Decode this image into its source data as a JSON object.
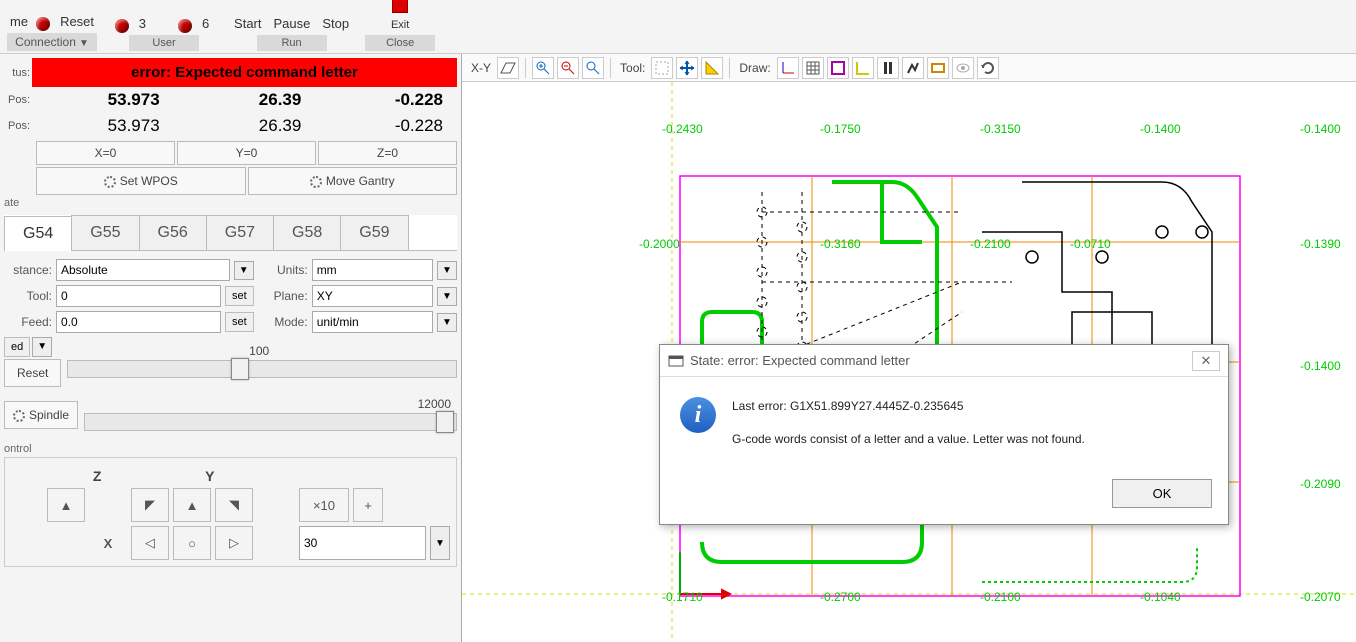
{
  "toolbar": {
    "home_label": "me",
    "reset_label": "Reset",
    "three_label": "3",
    "six_label": "6",
    "start_label": "Start",
    "pause_label": "Pause",
    "stop_label": "Stop",
    "exit_label": "Exit",
    "connection_group": "Connection",
    "user_group": "User",
    "run_group": "Run",
    "close_group": "Close"
  },
  "status": {
    "label": "tus:",
    "text": "error: Expected command letter"
  },
  "positions": {
    "mpos_label": "Pos:",
    "wpos_label": "Pos:",
    "mpos": {
      "x": "53.973",
      "y": "26.39",
      "z": "-0.228"
    },
    "wpos": {
      "x": "53.973",
      "y": "26.39",
      "z": "-0.228"
    }
  },
  "zero_buttons": {
    "x": "X=0",
    "y": "Y=0",
    "z": "Z=0"
  },
  "wpos_buttons": {
    "set": "Set WPOS",
    "move": "Move Gantry"
  },
  "state_label": "ate",
  "gcoords": [
    "G54",
    "G55",
    "G56",
    "G57",
    "G58",
    "G59"
  ],
  "settings": {
    "distance_label": "stance:",
    "distance_value": "Absolute",
    "tool_label": "Tool:",
    "tool_value": "0",
    "tool_set": "set",
    "feed_label": "Feed:",
    "feed_value": "0.0",
    "feed_set": "set",
    "units_label": "Units:",
    "units_value": "mm",
    "plane_label": "Plane:",
    "plane_value": "XY",
    "mode_label": "Mode:",
    "mode_value": "unit/min"
  },
  "speed": {
    "label": "ed",
    "reset": "Reset",
    "value": "100"
  },
  "spindle": {
    "label": "Spindle",
    "value": "12000"
  },
  "control": {
    "label": "ontrol",
    "z": "Z",
    "y": "Y",
    "x": "X",
    "mult": "×10",
    "plus": "+",
    "step_value": "30"
  },
  "canvas_toolbar": {
    "xy": "X-Y",
    "tool": "Tool:",
    "draw": "Draw:"
  },
  "coords": {
    "c1": "-0.2430",
    "c2": "-0.1750",
    "c3": "-0.3150",
    "c4": "-0.1400",
    "c5": "-0.1400",
    "c6": "-0.2000",
    "c7": "-0.3160",
    "c8": "-0.2100",
    "c9": "-0.0710",
    "c10": "-0.1390",
    "c11": "-0.1400",
    "c12": "-0.2090",
    "c13": "-0.1710",
    "c14": "-0.2700",
    "c15": "-0.2100",
    "c16": "-0.1040",
    "c17": "-0.2070"
  },
  "dialog": {
    "title": "State: error: Expected command letter",
    "line1": "Last error: G1X51.899Y27.4445Z-0.235645",
    "line2": "G-code words consist of a letter and a value. Letter was not found.",
    "ok": "OK"
  }
}
